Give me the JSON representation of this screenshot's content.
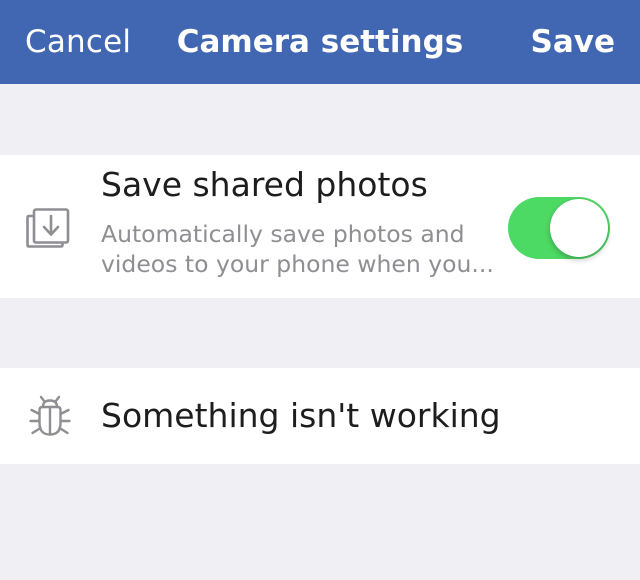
{
  "navbar": {
    "cancel_label": "Cancel",
    "title": "Camera settings",
    "save_label": "Save",
    "background_color": "#4267b2"
  },
  "settings": {
    "save_shared_photos": {
      "icon": "photo-download-icon",
      "title": "Save shared photos",
      "subtitle_line1": "Automatically save photos and",
      "subtitle_line2": "videos to your phone when you...",
      "toggle_on": true,
      "toggle_color": "#4cd964"
    },
    "report_problem": {
      "icon": "bug-icon",
      "title": "Something isn't working"
    }
  }
}
